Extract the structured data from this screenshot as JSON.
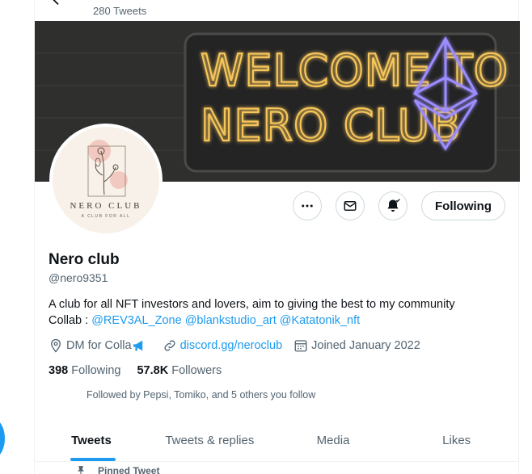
{
  "header": {
    "tweet_count": "280 Tweets"
  },
  "banner": {
    "line1": "WELCOME TO",
    "line2": "NERO CLUB"
  },
  "avatar": {
    "title": "NERO CLUB",
    "subtitle": "A CLUB FOR ALL"
  },
  "actions": {
    "following_label": "Following"
  },
  "profile": {
    "name": "Nero club",
    "handle": "@nero9351",
    "bio_line1": "A club for all NFT investors and lovers, aim to giving the best to my community",
    "bio_collab": "Collab : ",
    "mention1": "@REV3AL_Zone",
    "mention2": "@blankstudio_art",
    "mention3": "@Katatonik_nft",
    "location": "DM for Colla",
    "website": "discord.gg/neroclub",
    "joined": "Joined January 2022"
  },
  "stats": {
    "following_count": "398",
    "following_label": "Following",
    "followers_count": "57.8K",
    "followers_label": "Followers"
  },
  "followed_by": "Followed by Pepsi, Tomiko, and 5 others you follow",
  "tabs": [
    {
      "label": "Tweets",
      "active": true
    },
    {
      "label": "Tweets & replies",
      "active": false
    },
    {
      "label": "Media",
      "active": false
    },
    {
      "label": "Likes",
      "active": false
    }
  ],
  "pinned_label": "Pinned Tweet",
  "colors": {
    "accent": "#1d9bf0",
    "neon_text": "#f7c65a",
    "neon_eth": "#9b8cff"
  },
  "icons": [
    "back-arrow-icon",
    "more-icon",
    "mail-icon",
    "bell-icon",
    "location-icon",
    "link-icon",
    "calendar-icon",
    "megaphone-icon",
    "pin-icon"
  ]
}
